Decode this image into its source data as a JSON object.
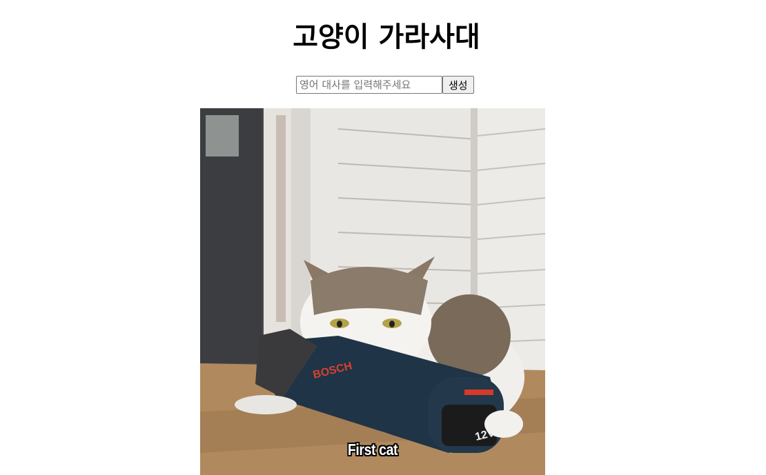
{
  "page": {
    "title": "고양이 가라사대"
  },
  "form": {
    "input_value": "",
    "input_placeholder": "영어 대사를 입력해주세요",
    "submit_label": "생성"
  },
  "meme": {
    "caption": "First cat",
    "drill_brand": "BOSCH",
    "battery_label": "12V"
  }
}
